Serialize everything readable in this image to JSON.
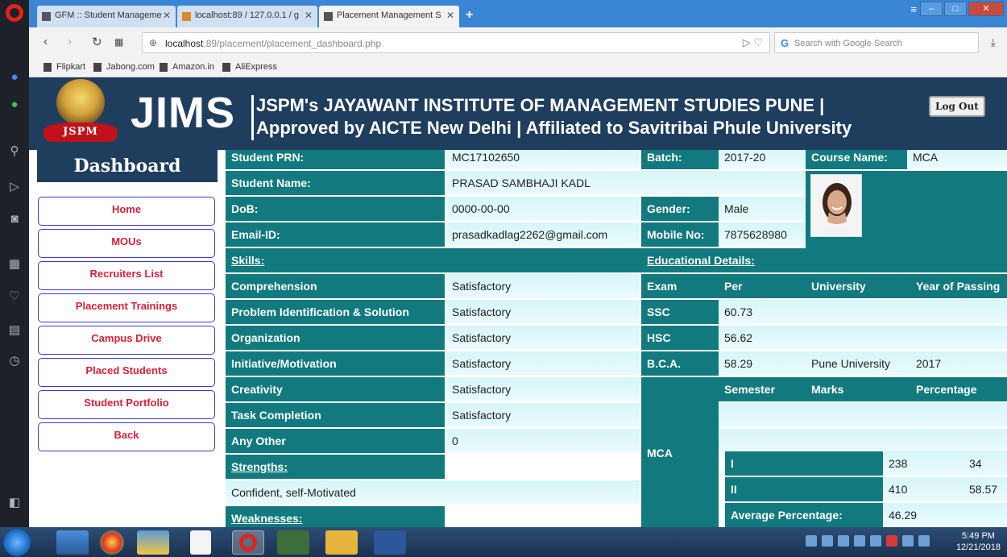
{
  "browser": {
    "tabs": [
      {
        "label": "GFM :: Student Manageme",
        "active": false
      },
      {
        "label": "localhost:89 / 127.0.0.1 / g",
        "active": false
      },
      {
        "label": "Placement Management S",
        "active": true
      }
    ],
    "url_host": "localhost",
    "url_path": ":89/placement/placement_dashboard.php",
    "search_placeholder": "Search with Google Search",
    "bookmarks": [
      "Flipkart",
      "Jabong.com",
      "Amazon.in",
      "AliExpress"
    ]
  },
  "header": {
    "logo_text": "JSPM",
    "brand": "JIMS",
    "line1": "JSPM's JAYAWANT INSTITUTE OF MANAGEMENT STUDIES PUNE |",
    "line2": "Approved by AICTE New Delhi | Affiliated to Savitribai Phule University",
    "logout": "Log Out"
  },
  "sidebar": {
    "title": "Dashboard",
    "items": [
      "Home",
      "MOUs",
      "Recruiters List",
      "Placement Trainings",
      "Campus Drive",
      "Placed Students",
      "Student Portfolio",
      "Back"
    ]
  },
  "student": {
    "prn_label": "Student PRN:",
    "prn": "MC17102650",
    "batch_label": "Batch:",
    "batch": "2017-20",
    "course_label": "Course Name:",
    "course": "MCA",
    "name_label": "Student Name:",
    "name": "PRASAD SAMBHAJI KADL",
    "dob_label": "DoB:",
    "dob": "0000-00-00",
    "gender_label": "Gender:",
    "gender": "Male",
    "email_label": "Email-ID:",
    "email": "prasadkadlag2262@gmail.com",
    "mobile_label": "Mobile No:",
    "mobile": "7875628980"
  },
  "skills": {
    "heading": "Skills:",
    "rows": [
      {
        "skill": "Comprehension",
        "value": "Satisfactory"
      },
      {
        "skill": "Problem Identification & Solution",
        "value": "Satisfactory"
      },
      {
        "skill": "Organization",
        "value": "Satisfactory"
      },
      {
        "skill": "Initiative/Motivation",
        "value": "Satisfactory"
      },
      {
        "skill": "Creativity",
        "value": "Satisfactory"
      },
      {
        "skill": "Task Completion",
        "value": "Satisfactory"
      },
      {
        "skill": "Any Other",
        "value": "0"
      }
    ],
    "strengths_heading": "Strengths:",
    "strengths": "Confident, self-Motivated",
    "weaknesses_heading": "Weaknesses:"
  },
  "education": {
    "heading": "Educational Details:",
    "columns": [
      "Exam",
      "Per",
      "University",
      "Year of Passing"
    ],
    "rows": [
      {
        "exam": "SSC",
        "per": "60.73",
        "university": "",
        "year": ""
      },
      {
        "exam": "HSC",
        "per": "56.62",
        "university": "",
        "year": ""
      },
      {
        "exam": "B.C.A.",
        "per": "58.29",
        "university": "Pune University",
        "year": "2017"
      }
    ],
    "mca_label": "MCA",
    "sem_columns": [
      "Semester",
      "Marks",
      "Percentage"
    ],
    "semesters": [
      {
        "sem": "I",
        "marks": "238",
        "pct": "34"
      },
      {
        "sem": "II",
        "marks": "410",
        "pct": "58.57"
      }
    ],
    "avg_label": "Average Percentage:",
    "avg_value": "46.29"
  },
  "taskbar": {
    "time": "5:49 PM",
    "date": "12/21/2018"
  }
}
